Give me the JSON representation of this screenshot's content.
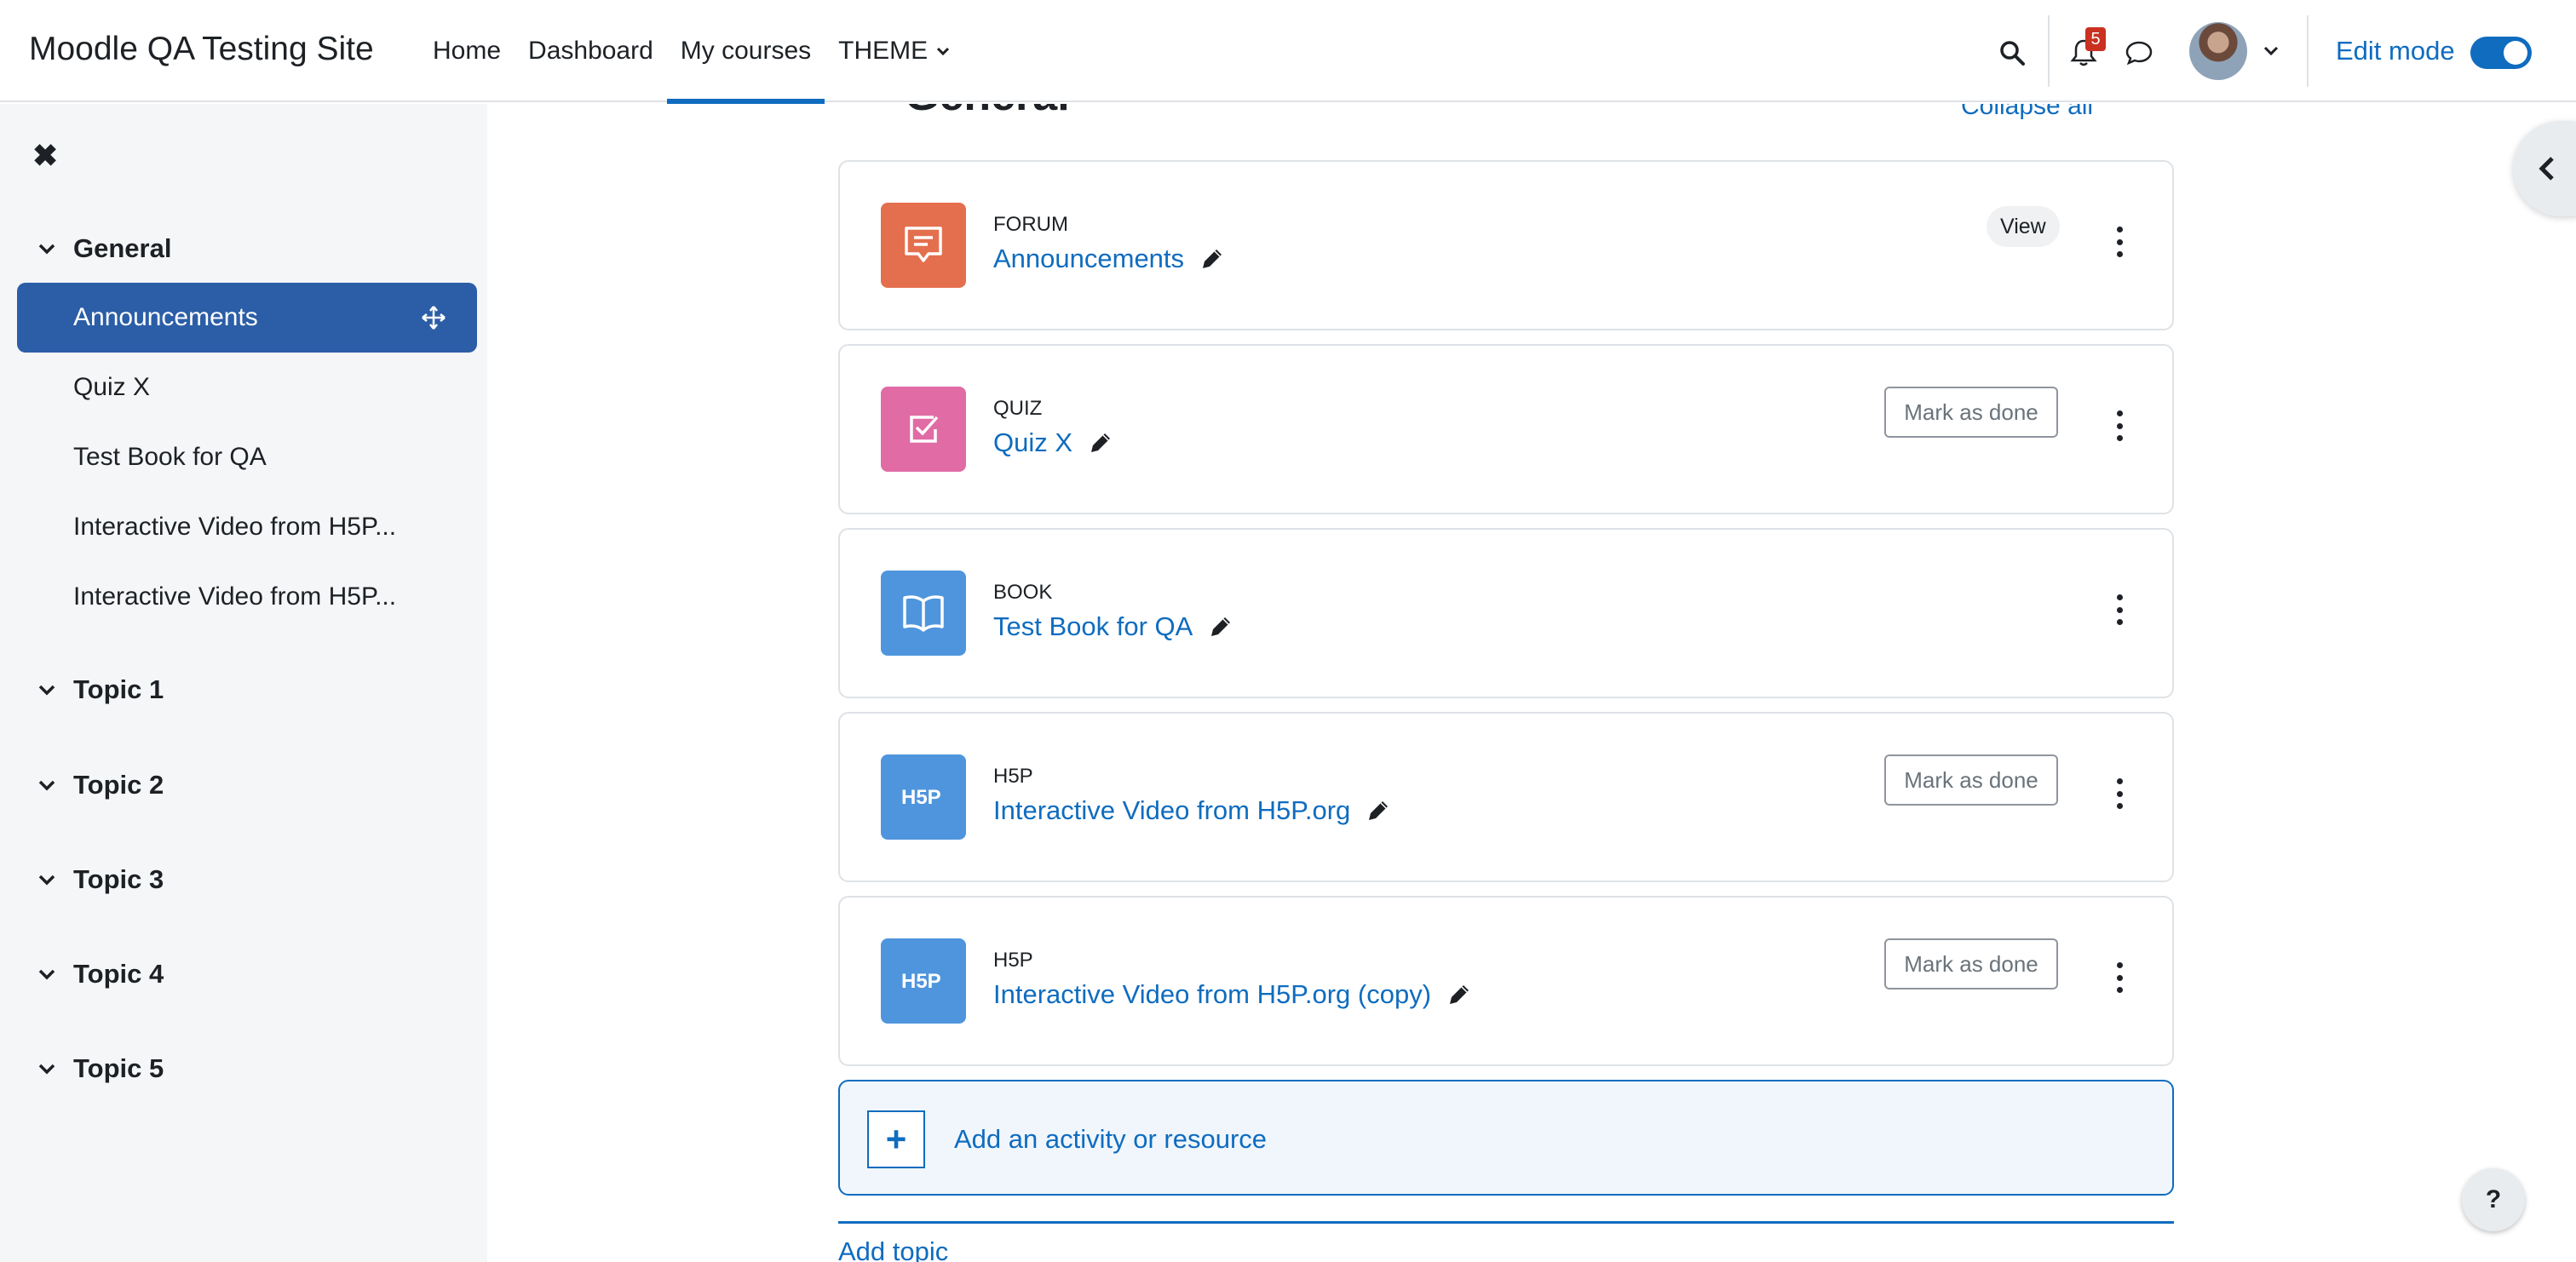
{
  "site": {
    "name": "Moodle QA Testing Site"
  },
  "nav": {
    "items": [
      {
        "label": "Home"
      },
      {
        "label": "Dashboard"
      },
      {
        "label": "My courses",
        "active": true
      },
      {
        "label": "THEME"
      }
    ],
    "notification_count": "5",
    "edit_mode_label": "Edit mode",
    "edit_mode_on": true
  },
  "course_index": {
    "sections": [
      {
        "title": "General",
        "activities": [
          "Announcements",
          "Quiz X",
          "Test Book for QA",
          "Interactive Video from H5P...",
          "Interactive Video from H5P..."
        ]
      },
      {
        "title": "Topic 1"
      },
      {
        "title": "Topic 2"
      },
      {
        "title": "Topic 3"
      },
      {
        "title": "Topic 4"
      },
      {
        "title": "Topic 5"
      }
    ],
    "active_activity": "Announcements"
  },
  "section": {
    "title": "General",
    "collapse_label": "Collapse all"
  },
  "activities": [
    {
      "type": "FORUM",
      "name": "Announcements",
      "action": "View",
      "icon": "forum-icon",
      "color": "#e46f4e"
    },
    {
      "type": "QUIZ",
      "name": "Quiz X",
      "action": "Mark as done",
      "icon": "quiz-icon",
      "color": "#e06ba5"
    },
    {
      "type": "BOOK",
      "name": "Test Book for QA",
      "action": "",
      "icon": "book-icon",
      "color": "#4f95dd"
    },
    {
      "type": "H5P",
      "name": "Interactive Video from H5P.org",
      "action": "Mark as done",
      "icon": "h5p-icon",
      "color": "#4f95dd"
    },
    {
      "type": "H5P",
      "name": "Interactive Video from H5P.org (copy)",
      "action": "Mark as done",
      "icon": "h5p-icon",
      "color": "#4f95dd"
    }
  ],
  "add_activity_label": "Add an activity or resource",
  "add_topic_label": "Add topic",
  "help_label": "?"
}
